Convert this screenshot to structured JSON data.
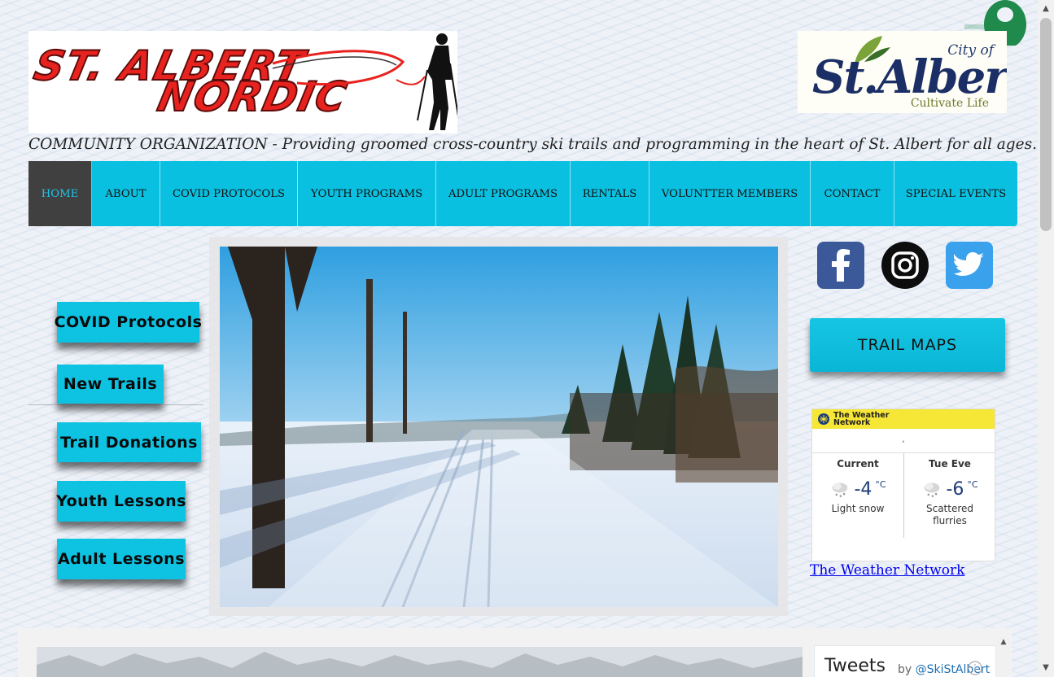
{
  "header": {
    "logo_line1": "ST. ALBERT",
    "logo_line2": "NORDIC",
    "city_logo_city": "City of",
    "city_logo_name": "St.Albert",
    "city_logo_tagline": "Cultivate Life",
    "tagline": "COMMUNITY ORGANIZATION - Providing groomed cross-country ski trails and programming in the heart of St. Albert for all ages."
  },
  "nav": {
    "items": [
      {
        "label": "HOME",
        "active": true
      },
      {
        "label": "ABOUT"
      },
      {
        "label": "COVID PROTOCOLS"
      },
      {
        "label": "YOUTH PROGRAMS"
      },
      {
        "label": "ADULT PROGRAMS"
      },
      {
        "label": "RENTALS"
      },
      {
        "label": "VOLUNTTER MEMBERS"
      },
      {
        "label": "CONTACT"
      },
      {
        "label": "SPECIAL EVENTS"
      }
    ]
  },
  "sidebar": {
    "buttons": [
      {
        "label": "COVID Protocols"
      },
      {
        "label": "New Trails"
      },
      {
        "label": "Trail Donations"
      },
      {
        "label": "Youth Lessons"
      },
      {
        "label": "Adult Lessons"
      }
    ]
  },
  "social": {
    "icons": [
      "facebook-icon",
      "instagram-icon",
      "twitter-icon"
    ]
  },
  "trail_maps": {
    "label": "TRAIL MAPS"
  },
  "weather": {
    "brand_line1": "The Weather",
    "brand_line2": "Network",
    "location": ",",
    "current": {
      "label": "Current",
      "temp": "-4",
      "unit": "°C",
      "desc": "Light snow"
    },
    "forecast": {
      "label": "Tue Eve",
      "temp": "-6",
      "unit": "°C",
      "desc": "Scattered flurries"
    },
    "link": "The Weather Network"
  },
  "tweets": {
    "title": "Tweets",
    "by": "by",
    "handle": "@SkiStAlbert"
  },
  "colors": {
    "nav_bg": "#0ac0e0",
    "nav_active_bg": "#404040",
    "button_bg": "#0ec2e1",
    "weather_bar": "#f6e636"
  }
}
